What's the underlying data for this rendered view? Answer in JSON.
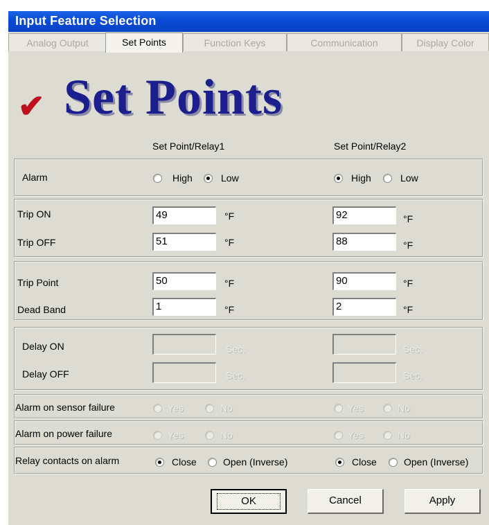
{
  "window": {
    "title": "Input Feature Selection"
  },
  "tabs": [
    {
      "label": "Analog Output",
      "active": false
    },
    {
      "label": "Set Points",
      "active": true
    },
    {
      "label": "Function Keys",
      "active": false
    },
    {
      "label": "Communication",
      "active": false
    },
    {
      "label": "Display Color",
      "active": false
    }
  ],
  "header": {
    "title": "Set Points",
    "check_glyph": "✔",
    "title_color": "#1b1e8c",
    "check_color": "#c0101d"
  },
  "columns": {
    "relay1": "Set Point/Relay1",
    "relay2": "Set Point/Relay2"
  },
  "alarm": {
    "label": "Alarm",
    "high_label": "High",
    "low_label": "Low",
    "relay1_selected": "Low",
    "relay2_selected": "High"
  },
  "trip": {
    "on_label": "Trip ON",
    "off_label": "Trip OFF",
    "relay1_on": "49",
    "relay1_off": "51",
    "relay2_on": "92",
    "relay2_off": "88",
    "unit": "°F"
  },
  "tripband": {
    "point_label": "Trip Point",
    "band_label": "Dead Band",
    "relay1_point": "50",
    "relay1_band": "1",
    "relay2_point": "90",
    "relay2_band": "2",
    "unit": "°F"
  },
  "delay": {
    "on_label": "Delay ON",
    "off_label": "Delay OFF",
    "unit": "Sec.",
    "enabled": false
  },
  "sensor_failure": {
    "label": "Alarm on sensor failure",
    "yes_label": "Yes",
    "no_label": "No",
    "enabled": false
  },
  "power_failure": {
    "label": "Alarm on power failure",
    "yes_label": "Yes",
    "no_label": "No",
    "enabled": false
  },
  "relay_contacts": {
    "label": "Relay contacts on alarm",
    "close_label": "Close",
    "open_label": "Open (Inverse)",
    "relay1_selected": "Close",
    "relay2_selected": "Close"
  },
  "buttons": {
    "ok": "OK",
    "cancel": "Cancel",
    "apply": "Apply"
  }
}
